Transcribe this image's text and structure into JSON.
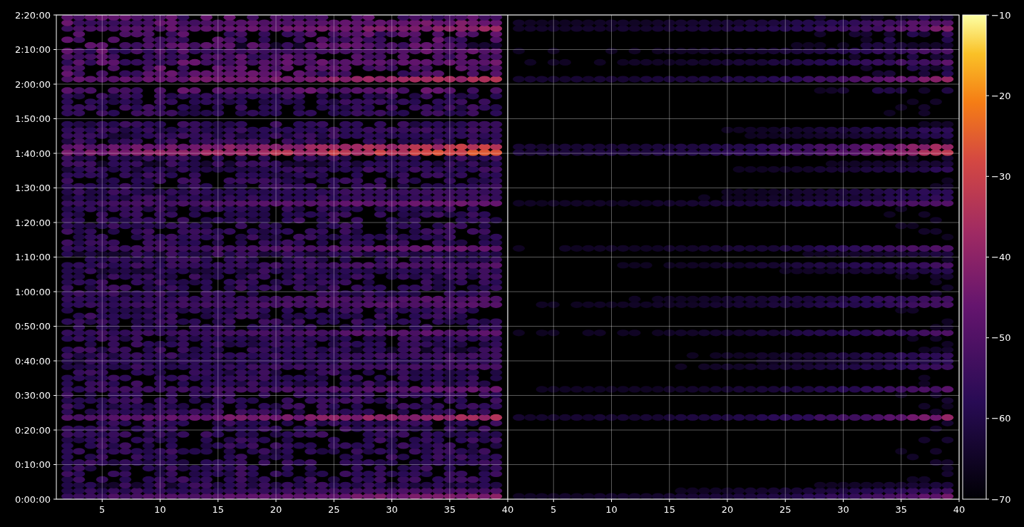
{
  "y_axis": {
    "ticks": [
      "2:20:00",
      "2:10:00",
      "2:00:00",
      "1:50:00",
      "1:40:00",
      "1:30:00",
      "1:20:00",
      "1:10:00",
      "1:00:00",
      "0:50:00",
      "0:40:00",
      "0:30:00",
      "0:20:00",
      "0:10:00",
      "0:00:00"
    ]
  },
  "x_axis_left": {
    "ticks": [
      "5",
      "10",
      "15",
      "20",
      "25",
      "30",
      "35",
      "40"
    ]
  },
  "x_axis_right": {
    "ticks": [
      "5",
      "10",
      "15",
      "20",
      "25",
      "30",
      "35",
      "40"
    ]
  },
  "colorbar": {
    "ticks": [
      "−10",
      "−20",
      "−30",
      "−40",
      "−50",
      "−60",
      "−70"
    ]
  }
}
